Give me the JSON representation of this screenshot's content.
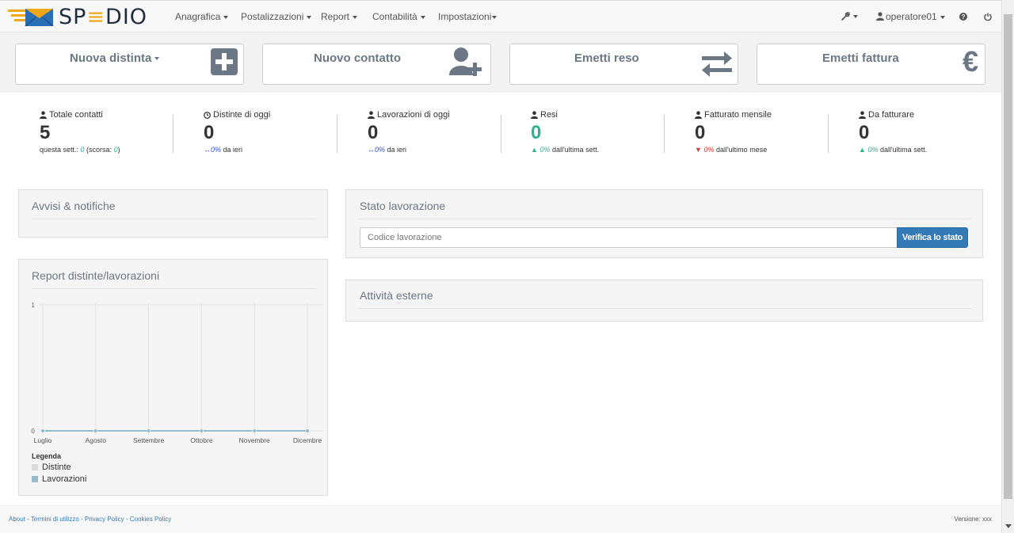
{
  "app": {
    "logo_text_1": "SP",
    "logo_text_2": "DIO"
  },
  "nav": {
    "items": [
      {
        "label": "Anagrafica"
      },
      {
        "label": "Postalizzazioni"
      },
      {
        "label": "Report"
      },
      {
        "label": "Contabilità"
      },
      {
        "label": "Impostazioni"
      }
    ],
    "user": "operatore01"
  },
  "actions": [
    {
      "label": "Nuova distinta"
    },
    {
      "label": "Nuovo contatto"
    },
    {
      "label": "Emetti reso"
    },
    {
      "label": "Emetti fattura"
    }
  ],
  "stats": [
    {
      "label": "Totale contatti",
      "value": "5",
      "sub_pre": "questa sett.: ",
      "sub_val1": "0",
      "sub_mid": " (scorsa: ",
      "sub_val2": "0",
      "sub_post": ")"
    },
    {
      "label": "Distinte di oggi",
      "value": "0",
      "trend": "0%",
      "sub_post": " da ieri"
    },
    {
      "label": "Lavorazioni di oggi",
      "value": "0",
      "trend": "0%",
      "sub_post": " da ieri"
    },
    {
      "label": "Resi",
      "value": "0",
      "trend": "0%",
      "sub_post": " dall'ultima sett."
    },
    {
      "label": "Fatturato mensile",
      "value": "0",
      "trend": "0%",
      "sub_post": " dall'ultimo mese"
    },
    {
      "label": "Da fatturare",
      "value": "0",
      "trend": "0%",
      "sub_post": " dall'ultima sett."
    }
  ],
  "panels": {
    "notifications": {
      "title": "Avvisi & notifiche"
    },
    "report": {
      "title": "Report distinte/lavorazioni"
    },
    "status": {
      "title": "Stato lavorazione",
      "input_placeholder": "Codice lavorazione",
      "button": "Verifica lo stato"
    },
    "external": {
      "title": "Attività esterne"
    }
  },
  "chart_data": {
    "type": "line",
    "categories": [
      "Luglio",
      "Agosto",
      "Settembre",
      "Ottobre",
      "Novembre",
      "Dicembre"
    ],
    "series": [
      {
        "name": "Distinte",
        "values": [
          0,
          0,
          0,
          0,
          0,
          0
        ],
        "color": "#dcdcdc"
      },
      {
        "name": "Lavorazioni",
        "values": [
          0,
          0,
          0,
          0,
          0,
          0
        ],
        "color": "#97bbcd"
      }
    ],
    "yticks": [
      "0",
      "1"
    ],
    "ylim": [
      0,
      1
    ],
    "legend_title": "Legenda",
    "legend_position": "bottom-left",
    "grid": true
  },
  "footer": {
    "links": [
      "About",
      "Termini di utilizzo",
      "Privacy Policy",
      "Cookies Policy"
    ],
    "separator": " - ",
    "version": "Versione: xxx"
  },
  "colors": {
    "accent": "#337ab7",
    "green": "#2fb193",
    "red": "#d9392c",
    "icon": "#6b7784",
    "logo_yellow": "#f0a81a"
  }
}
